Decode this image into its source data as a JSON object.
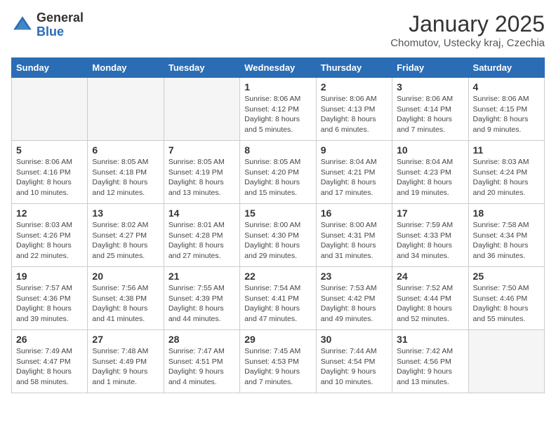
{
  "header": {
    "logo_general": "General",
    "logo_blue": "Blue",
    "title": "January 2025",
    "subtitle": "Chomutov, Ustecky kraj, Czechia"
  },
  "weekdays": [
    "Sunday",
    "Monday",
    "Tuesday",
    "Wednesday",
    "Thursday",
    "Friday",
    "Saturday"
  ],
  "weeks": [
    [
      {
        "day": "",
        "info": "",
        "empty": true
      },
      {
        "day": "",
        "info": "",
        "empty": true
      },
      {
        "day": "",
        "info": "",
        "empty": true
      },
      {
        "day": "1",
        "info": "Sunrise: 8:06 AM\nSunset: 4:12 PM\nDaylight: 8 hours\nand 5 minutes."
      },
      {
        "day": "2",
        "info": "Sunrise: 8:06 AM\nSunset: 4:13 PM\nDaylight: 8 hours\nand 6 minutes."
      },
      {
        "day": "3",
        "info": "Sunrise: 8:06 AM\nSunset: 4:14 PM\nDaylight: 8 hours\nand 7 minutes."
      },
      {
        "day": "4",
        "info": "Sunrise: 8:06 AM\nSunset: 4:15 PM\nDaylight: 8 hours\nand 9 minutes."
      }
    ],
    [
      {
        "day": "5",
        "info": "Sunrise: 8:06 AM\nSunset: 4:16 PM\nDaylight: 8 hours\nand 10 minutes."
      },
      {
        "day": "6",
        "info": "Sunrise: 8:05 AM\nSunset: 4:18 PM\nDaylight: 8 hours\nand 12 minutes."
      },
      {
        "day": "7",
        "info": "Sunrise: 8:05 AM\nSunset: 4:19 PM\nDaylight: 8 hours\nand 13 minutes."
      },
      {
        "day": "8",
        "info": "Sunrise: 8:05 AM\nSunset: 4:20 PM\nDaylight: 8 hours\nand 15 minutes."
      },
      {
        "day": "9",
        "info": "Sunrise: 8:04 AM\nSunset: 4:21 PM\nDaylight: 8 hours\nand 17 minutes."
      },
      {
        "day": "10",
        "info": "Sunrise: 8:04 AM\nSunset: 4:23 PM\nDaylight: 8 hours\nand 19 minutes."
      },
      {
        "day": "11",
        "info": "Sunrise: 8:03 AM\nSunset: 4:24 PM\nDaylight: 8 hours\nand 20 minutes."
      }
    ],
    [
      {
        "day": "12",
        "info": "Sunrise: 8:03 AM\nSunset: 4:26 PM\nDaylight: 8 hours\nand 22 minutes."
      },
      {
        "day": "13",
        "info": "Sunrise: 8:02 AM\nSunset: 4:27 PM\nDaylight: 8 hours\nand 25 minutes."
      },
      {
        "day": "14",
        "info": "Sunrise: 8:01 AM\nSunset: 4:28 PM\nDaylight: 8 hours\nand 27 minutes."
      },
      {
        "day": "15",
        "info": "Sunrise: 8:00 AM\nSunset: 4:30 PM\nDaylight: 8 hours\nand 29 minutes."
      },
      {
        "day": "16",
        "info": "Sunrise: 8:00 AM\nSunset: 4:31 PM\nDaylight: 8 hours\nand 31 minutes."
      },
      {
        "day": "17",
        "info": "Sunrise: 7:59 AM\nSunset: 4:33 PM\nDaylight: 8 hours\nand 34 minutes."
      },
      {
        "day": "18",
        "info": "Sunrise: 7:58 AM\nSunset: 4:34 PM\nDaylight: 8 hours\nand 36 minutes."
      }
    ],
    [
      {
        "day": "19",
        "info": "Sunrise: 7:57 AM\nSunset: 4:36 PM\nDaylight: 8 hours\nand 39 minutes."
      },
      {
        "day": "20",
        "info": "Sunrise: 7:56 AM\nSunset: 4:38 PM\nDaylight: 8 hours\nand 41 minutes."
      },
      {
        "day": "21",
        "info": "Sunrise: 7:55 AM\nSunset: 4:39 PM\nDaylight: 8 hours\nand 44 minutes."
      },
      {
        "day": "22",
        "info": "Sunrise: 7:54 AM\nSunset: 4:41 PM\nDaylight: 8 hours\nand 47 minutes."
      },
      {
        "day": "23",
        "info": "Sunrise: 7:53 AM\nSunset: 4:42 PM\nDaylight: 8 hours\nand 49 minutes."
      },
      {
        "day": "24",
        "info": "Sunrise: 7:52 AM\nSunset: 4:44 PM\nDaylight: 8 hours\nand 52 minutes."
      },
      {
        "day": "25",
        "info": "Sunrise: 7:50 AM\nSunset: 4:46 PM\nDaylight: 8 hours\nand 55 minutes."
      }
    ],
    [
      {
        "day": "26",
        "info": "Sunrise: 7:49 AM\nSunset: 4:47 PM\nDaylight: 8 hours\nand 58 minutes."
      },
      {
        "day": "27",
        "info": "Sunrise: 7:48 AM\nSunset: 4:49 PM\nDaylight: 9 hours\nand 1 minute."
      },
      {
        "day": "28",
        "info": "Sunrise: 7:47 AM\nSunset: 4:51 PM\nDaylight: 9 hours\nand 4 minutes."
      },
      {
        "day": "29",
        "info": "Sunrise: 7:45 AM\nSunset: 4:53 PM\nDaylight: 9 hours\nand 7 minutes."
      },
      {
        "day": "30",
        "info": "Sunrise: 7:44 AM\nSunset: 4:54 PM\nDaylight: 9 hours\nand 10 minutes."
      },
      {
        "day": "31",
        "info": "Sunrise: 7:42 AM\nSunset: 4:56 PM\nDaylight: 9 hours\nand 13 minutes."
      },
      {
        "day": "",
        "info": "",
        "empty": true
      }
    ]
  ]
}
